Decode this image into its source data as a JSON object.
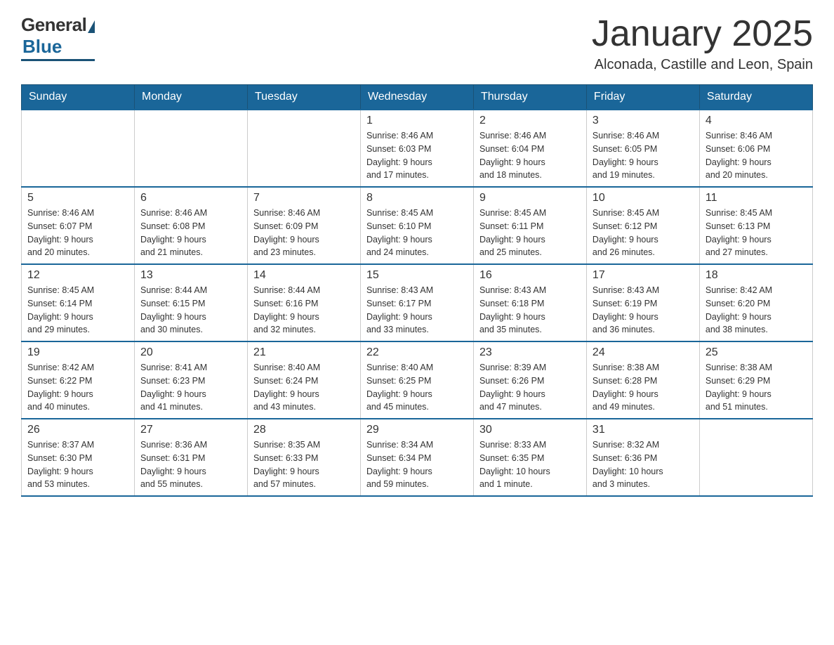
{
  "logo": {
    "general": "General",
    "blue": "Blue"
  },
  "header": {
    "title": "January 2025",
    "location": "Alconada, Castille and Leon, Spain"
  },
  "weekdays": [
    "Sunday",
    "Monday",
    "Tuesday",
    "Wednesday",
    "Thursday",
    "Friday",
    "Saturday"
  ],
  "weeks": [
    [
      {
        "day": "",
        "info": ""
      },
      {
        "day": "",
        "info": ""
      },
      {
        "day": "",
        "info": ""
      },
      {
        "day": "1",
        "info": "Sunrise: 8:46 AM\nSunset: 6:03 PM\nDaylight: 9 hours\nand 17 minutes."
      },
      {
        "day": "2",
        "info": "Sunrise: 8:46 AM\nSunset: 6:04 PM\nDaylight: 9 hours\nand 18 minutes."
      },
      {
        "day": "3",
        "info": "Sunrise: 8:46 AM\nSunset: 6:05 PM\nDaylight: 9 hours\nand 19 minutes."
      },
      {
        "day": "4",
        "info": "Sunrise: 8:46 AM\nSunset: 6:06 PM\nDaylight: 9 hours\nand 20 minutes."
      }
    ],
    [
      {
        "day": "5",
        "info": "Sunrise: 8:46 AM\nSunset: 6:07 PM\nDaylight: 9 hours\nand 20 minutes."
      },
      {
        "day": "6",
        "info": "Sunrise: 8:46 AM\nSunset: 6:08 PM\nDaylight: 9 hours\nand 21 minutes."
      },
      {
        "day": "7",
        "info": "Sunrise: 8:46 AM\nSunset: 6:09 PM\nDaylight: 9 hours\nand 23 minutes."
      },
      {
        "day": "8",
        "info": "Sunrise: 8:45 AM\nSunset: 6:10 PM\nDaylight: 9 hours\nand 24 minutes."
      },
      {
        "day": "9",
        "info": "Sunrise: 8:45 AM\nSunset: 6:11 PM\nDaylight: 9 hours\nand 25 minutes."
      },
      {
        "day": "10",
        "info": "Sunrise: 8:45 AM\nSunset: 6:12 PM\nDaylight: 9 hours\nand 26 minutes."
      },
      {
        "day": "11",
        "info": "Sunrise: 8:45 AM\nSunset: 6:13 PM\nDaylight: 9 hours\nand 27 minutes."
      }
    ],
    [
      {
        "day": "12",
        "info": "Sunrise: 8:45 AM\nSunset: 6:14 PM\nDaylight: 9 hours\nand 29 minutes."
      },
      {
        "day": "13",
        "info": "Sunrise: 8:44 AM\nSunset: 6:15 PM\nDaylight: 9 hours\nand 30 minutes."
      },
      {
        "day": "14",
        "info": "Sunrise: 8:44 AM\nSunset: 6:16 PM\nDaylight: 9 hours\nand 32 minutes."
      },
      {
        "day": "15",
        "info": "Sunrise: 8:43 AM\nSunset: 6:17 PM\nDaylight: 9 hours\nand 33 minutes."
      },
      {
        "day": "16",
        "info": "Sunrise: 8:43 AM\nSunset: 6:18 PM\nDaylight: 9 hours\nand 35 minutes."
      },
      {
        "day": "17",
        "info": "Sunrise: 8:43 AM\nSunset: 6:19 PM\nDaylight: 9 hours\nand 36 minutes."
      },
      {
        "day": "18",
        "info": "Sunrise: 8:42 AM\nSunset: 6:20 PM\nDaylight: 9 hours\nand 38 minutes."
      }
    ],
    [
      {
        "day": "19",
        "info": "Sunrise: 8:42 AM\nSunset: 6:22 PM\nDaylight: 9 hours\nand 40 minutes."
      },
      {
        "day": "20",
        "info": "Sunrise: 8:41 AM\nSunset: 6:23 PM\nDaylight: 9 hours\nand 41 minutes."
      },
      {
        "day": "21",
        "info": "Sunrise: 8:40 AM\nSunset: 6:24 PM\nDaylight: 9 hours\nand 43 minutes."
      },
      {
        "day": "22",
        "info": "Sunrise: 8:40 AM\nSunset: 6:25 PM\nDaylight: 9 hours\nand 45 minutes."
      },
      {
        "day": "23",
        "info": "Sunrise: 8:39 AM\nSunset: 6:26 PM\nDaylight: 9 hours\nand 47 minutes."
      },
      {
        "day": "24",
        "info": "Sunrise: 8:38 AM\nSunset: 6:28 PM\nDaylight: 9 hours\nand 49 minutes."
      },
      {
        "day": "25",
        "info": "Sunrise: 8:38 AM\nSunset: 6:29 PM\nDaylight: 9 hours\nand 51 minutes."
      }
    ],
    [
      {
        "day": "26",
        "info": "Sunrise: 8:37 AM\nSunset: 6:30 PM\nDaylight: 9 hours\nand 53 minutes."
      },
      {
        "day": "27",
        "info": "Sunrise: 8:36 AM\nSunset: 6:31 PM\nDaylight: 9 hours\nand 55 minutes."
      },
      {
        "day": "28",
        "info": "Sunrise: 8:35 AM\nSunset: 6:33 PM\nDaylight: 9 hours\nand 57 minutes."
      },
      {
        "day": "29",
        "info": "Sunrise: 8:34 AM\nSunset: 6:34 PM\nDaylight: 9 hours\nand 59 minutes."
      },
      {
        "day": "30",
        "info": "Sunrise: 8:33 AM\nSunset: 6:35 PM\nDaylight: 10 hours\nand 1 minute."
      },
      {
        "day": "31",
        "info": "Sunrise: 8:32 AM\nSunset: 6:36 PM\nDaylight: 10 hours\nand 3 minutes."
      },
      {
        "day": "",
        "info": ""
      }
    ]
  ]
}
